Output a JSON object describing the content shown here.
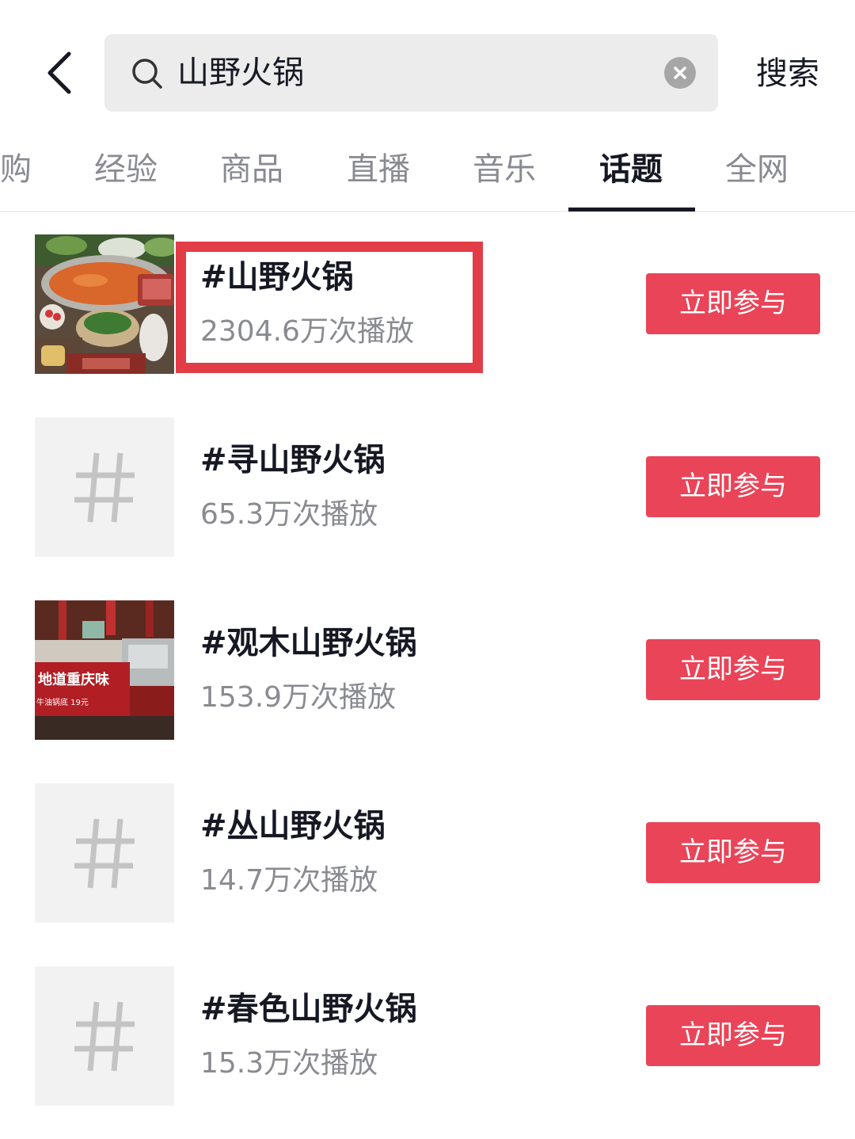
{
  "header": {
    "back_icon": "chevron-left-icon",
    "search_icon": "search-icon",
    "search_value": "山野火锅",
    "search_placeholder": "",
    "clear_icon": "clear-icon",
    "search_button": "搜索"
  },
  "tabs": [
    {
      "label": "购",
      "active": false
    },
    {
      "label": "经验",
      "active": false
    },
    {
      "label": "商品",
      "active": false
    },
    {
      "label": "直播",
      "active": false
    },
    {
      "label": "音乐",
      "active": false
    },
    {
      "label": "话题",
      "active": true
    },
    {
      "label": "全网",
      "active": false
    }
  ],
  "topics": [
    {
      "title": "#山野火锅",
      "plays": "2304.6万次播放",
      "thumb": "hotpot-photo",
      "button": "立即参与",
      "highlighted": true
    },
    {
      "title": "#寻山野火锅",
      "plays": "65.3万次播放",
      "thumb": "hashtag-icon",
      "button": "立即参与",
      "highlighted": false
    },
    {
      "title": "#观木山野火锅",
      "plays": "153.9万次播放",
      "thumb": "restaurant-photo",
      "button": "立即参与",
      "highlighted": false
    },
    {
      "title": "#丛山野火锅",
      "plays": "14.7万次播放",
      "thumb": "hashtag-icon",
      "button": "立即参与",
      "highlighted": false
    },
    {
      "title": "#春色山野火锅",
      "plays": "15.3万次播放",
      "thumb": "hashtag-icon",
      "button": "立即参与",
      "highlighted": false
    }
  ],
  "photo_text": {
    "sign_main": "地道重庆味",
    "sign_sub": "牛油锅底 19元"
  },
  "colors": {
    "accent": "#ea4458",
    "highlight": "#e23d47",
    "text_primary": "#161823",
    "text_secondary": "#8a8b91",
    "search_bg": "#ececec"
  }
}
